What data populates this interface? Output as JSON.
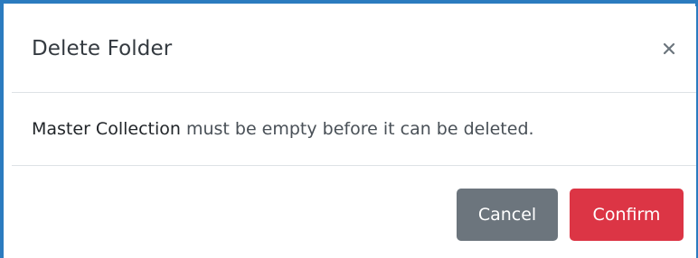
{
  "dialog": {
    "title": "Delete Folder",
    "close_icon": "close-icon",
    "message": {
      "folder_name": "Master Collection",
      "text": " must be empty before it can be deleted."
    },
    "buttons": {
      "cancel_label": "Cancel",
      "confirm_label": "Confirm"
    }
  },
  "colors": {
    "frame_accent": "#2b7bbf",
    "cancel": "#6c757d",
    "confirm": "#dc3545",
    "divider": "#dee2e6"
  }
}
